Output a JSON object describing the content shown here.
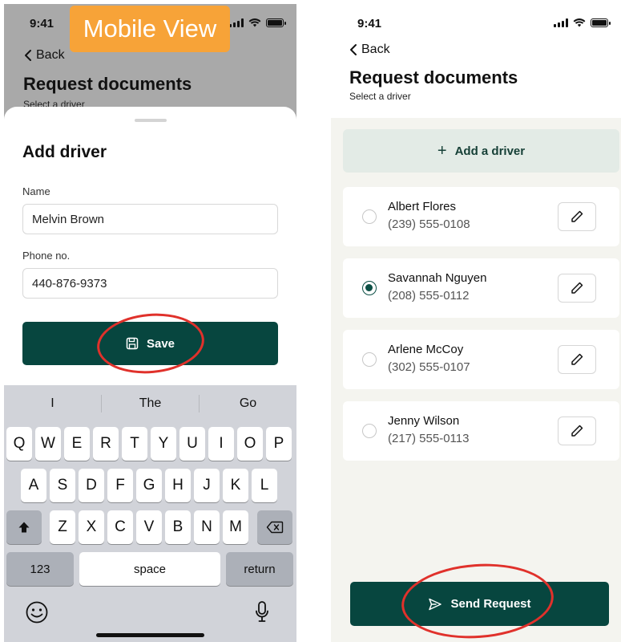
{
  "annotation_label": "Mobile View",
  "left_screen": {
    "status_time": "9:41",
    "back_label": "Back",
    "title": "Request documents",
    "subtitle": "Select a driver",
    "sheet": {
      "title": "Add driver",
      "name_label": "Name",
      "name_value": "Melvin Brown",
      "phone_label": "Phone no.",
      "phone_value": "440-876-9373",
      "save_label": "Save"
    },
    "keyboard": {
      "suggestions": [
        "I",
        "The",
        "Go"
      ],
      "row1": [
        "Q",
        "W",
        "E",
        "R",
        "T",
        "Y",
        "U",
        "I",
        "O",
        "P"
      ],
      "row2": [
        "A",
        "S",
        "D",
        "F",
        "G",
        "H",
        "J",
        "K",
        "L"
      ],
      "row3": [
        "Z",
        "X",
        "C",
        "V",
        "B",
        "N",
        "M"
      ],
      "numbers_key": "123",
      "space_key": "space",
      "return_key": "return"
    }
  },
  "right_screen": {
    "status_time": "9:41",
    "back_label": "Back",
    "title": "Request documents",
    "subtitle": "Select a driver",
    "add_driver_label": "Add a driver",
    "drivers": [
      {
        "name": "Albert Flores",
        "phone": "(239) 555-0108",
        "selected": false
      },
      {
        "name": "Savannah Nguyen",
        "phone": "(208) 555-0112",
        "selected": true
      },
      {
        "name": "Arlene McCoy",
        "phone": "(302) 555-0107",
        "selected": false
      },
      {
        "name": "Jenny Wilson",
        "phone": "(217) 555-0113",
        "selected": false
      }
    ],
    "send_label": "Send Request"
  },
  "colors": {
    "primary": "#07463f",
    "accent_tag": "#f7a338",
    "annotation_circle": "#e0312b",
    "add_driver_bg": "#e3ebe6"
  }
}
